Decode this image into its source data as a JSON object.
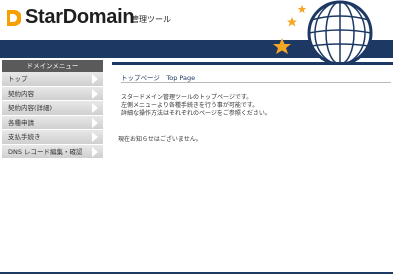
{
  "header": {
    "logo_text": "StarDomain",
    "tool_label": "管理ツール"
  },
  "sidebar": {
    "title": "ドメインメニュー",
    "items": [
      {
        "label": "トップ"
      },
      {
        "label": "契約内容"
      },
      {
        "label": "契約内容(詳細)"
      },
      {
        "label": "各種申請"
      },
      {
        "label": "支払手続き"
      },
      {
        "label": "DNS レコード編集・確認"
      }
    ]
  },
  "main": {
    "page_title": "トップページ　Top Page",
    "body_lines": [
      "スタードメイン管理ツールのトップページです。",
      "左側メニューより各種手続きを行う事が可能です。",
      "詳細な操作方法はそれぞれのページをご参照ください。"
    ],
    "notice": "現在お知らせはございません。"
  },
  "colors": {
    "navy": "#1c3863",
    "star": "#f5a623",
    "logo_orange": "#f5a000"
  }
}
